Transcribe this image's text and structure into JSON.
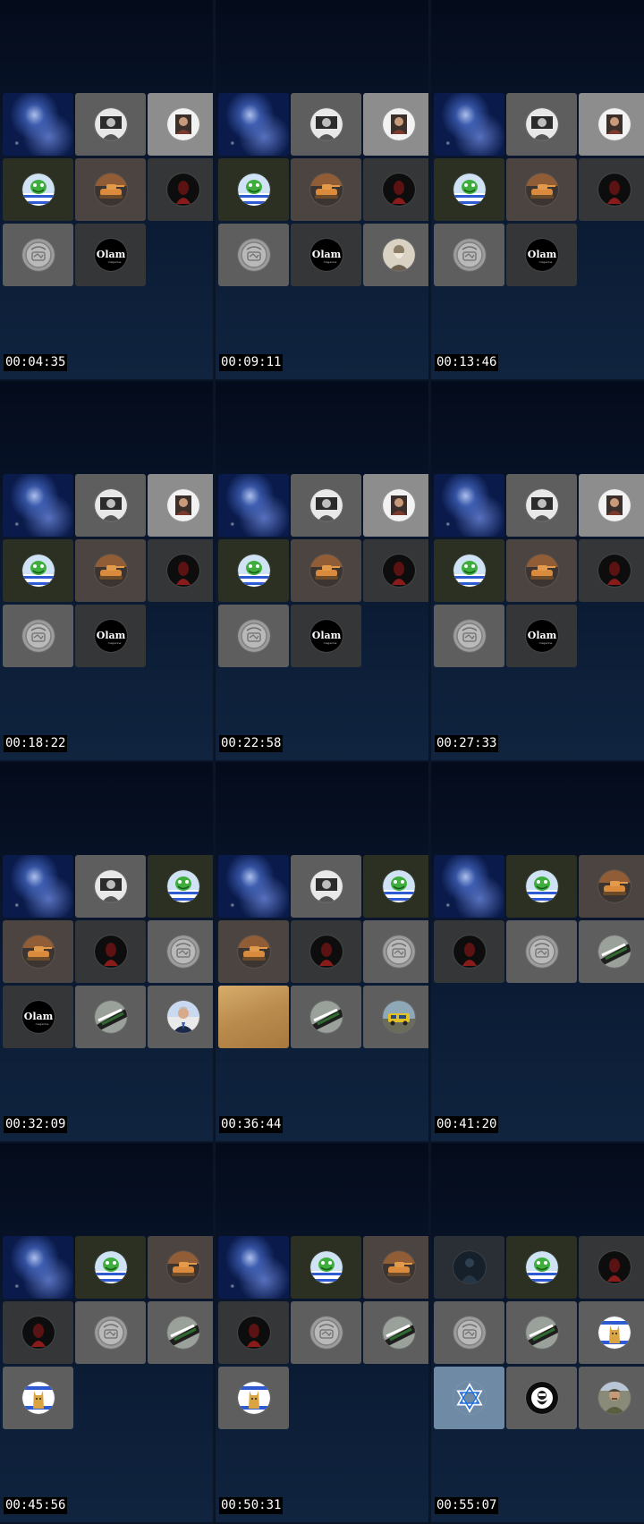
{
  "frames": [
    {
      "timestamp": "00:04:35",
      "tiles": [
        {
          "bg": "nebula"
        },
        {
          "bg": "gray",
          "icon": "portrait-bw-icon"
        },
        {
          "bg": "light",
          "icon": "portrait-photo-icon"
        },
        {
          "bg": "olive",
          "icon": "green-character-flag-icon"
        },
        {
          "bg": "brown",
          "icon": "tank-icon"
        },
        {
          "bg": "dark",
          "icon": "red-figure-icon"
        },
        {
          "bg": "gray",
          "icon": "coin-emblem-icon"
        },
        {
          "bg": "dark",
          "icon": "olam-logo-icon"
        }
      ]
    },
    {
      "timestamp": "00:09:11",
      "tiles": [
        {
          "bg": "nebula"
        },
        {
          "bg": "gray",
          "icon": "portrait-bw-icon"
        },
        {
          "bg": "light",
          "icon": "portrait-photo-icon"
        },
        {
          "bg": "olive",
          "icon": "green-character-flag-icon"
        },
        {
          "bg": "brown",
          "icon": "tank-icon"
        },
        {
          "bg": "dark",
          "icon": "red-figure-icon"
        },
        {
          "bg": "gray",
          "icon": "coin-emblem-icon"
        },
        {
          "bg": "dark",
          "icon": "olam-logo-icon"
        },
        {
          "bg": "gray",
          "icon": "old-man-portrait-icon"
        }
      ]
    },
    {
      "timestamp": "00:13:46",
      "tiles": [
        {
          "bg": "nebula"
        },
        {
          "bg": "gray",
          "icon": "portrait-bw-icon"
        },
        {
          "bg": "light",
          "icon": "portrait-photo-icon"
        },
        {
          "bg": "olive",
          "icon": "green-character-flag-icon"
        },
        {
          "bg": "brown",
          "icon": "tank-icon"
        },
        {
          "bg": "dark",
          "icon": "red-figure-icon"
        },
        {
          "bg": "gray",
          "icon": "coin-emblem-icon"
        },
        {
          "bg": "dark",
          "icon": "olam-logo-icon"
        }
      ]
    },
    {
      "timestamp": "00:18:22",
      "tiles": [
        {
          "bg": "nebula"
        },
        {
          "bg": "gray",
          "icon": "portrait-bw-icon"
        },
        {
          "bg": "light",
          "icon": "portrait-photo-icon"
        },
        {
          "bg": "olive",
          "icon": "green-character-flag-icon"
        },
        {
          "bg": "brown",
          "icon": "tank-icon"
        },
        {
          "bg": "dark",
          "icon": "red-figure-icon"
        },
        {
          "bg": "gray",
          "icon": "coin-emblem-icon"
        },
        {
          "bg": "dark",
          "icon": "olam-logo-icon"
        }
      ]
    },
    {
      "timestamp": "00:22:58",
      "tiles": [
        {
          "bg": "nebula"
        },
        {
          "bg": "gray",
          "icon": "portrait-bw-icon"
        },
        {
          "bg": "light",
          "icon": "portrait-photo-icon"
        },
        {
          "bg": "olive",
          "icon": "green-character-flag-icon"
        },
        {
          "bg": "brown",
          "icon": "tank-icon"
        },
        {
          "bg": "dark",
          "icon": "red-figure-icon"
        },
        {
          "bg": "gray",
          "icon": "coin-emblem-icon"
        },
        {
          "bg": "dark",
          "icon": "olam-logo-icon"
        }
      ]
    },
    {
      "timestamp": "00:27:33",
      "tiles": [
        {
          "bg": "nebula"
        },
        {
          "bg": "gray",
          "icon": "portrait-bw-icon"
        },
        {
          "bg": "light",
          "icon": "portrait-photo-icon"
        },
        {
          "bg": "olive",
          "icon": "green-character-flag-icon"
        },
        {
          "bg": "brown",
          "icon": "tank-icon"
        },
        {
          "bg": "dark",
          "icon": "red-figure-icon"
        },
        {
          "bg": "gray",
          "icon": "coin-emblem-icon"
        },
        {
          "bg": "dark",
          "icon": "olam-logo-icon"
        }
      ]
    },
    {
      "timestamp": "00:32:09",
      "tiles": [
        {
          "bg": "nebula"
        },
        {
          "bg": "gray",
          "icon": "portrait-bw-icon"
        },
        {
          "bg": "olive",
          "icon": "green-character-flag-icon"
        },
        {
          "bg": "brown",
          "icon": "tank-icon"
        },
        {
          "bg": "dark",
          "icon": "red-figure-icon"
        },
        {
          "bg": "gray",
          "icon": "coin-emblem-icon"
        },
        {
          "bg": "dark",
          "icon": "olam-logo-icon"
        },
        {
          "bg": "gray",
          "icon": "soldier-flag-icon"
        },
        {
          "bg": "gray",
          "icon": "politician-portrait-icon"
        }
      ]
    },
    {
      "timestamp": "00:36:44",
      "tiles": [
        {
          "bg": "nebula"
        },
        {
          "bg": "gray",
          "icon": "portrait-bw-icon"
        },
        {
          "bg": "olive",
          "icon": "green-character-flag-icon"
        },
        {
          "bg": "brown",
          "icon": "tank-icon"
        },
        {
          "bg": "dark",
          "icon": "red-figure-icon"
        },
        {
          "bg": "gray",
          "icon": "coin-emblem-icon"
        },
        {
          "bg": "sand"
        },
        {
          "bg": "gray",
          "icon": "soldier-flag-icon"
        },
        {
          "bg": "gray",
          "icon": "vehicle-photo-icon"
        }
      ]
    },
    {
      "timestamp": "00:41:20",
      "tiles": [
        {
          "bg": "nebula"
        },
        {
          "bg": "olive",
          "icon": "green-character-flag-icon"
        },
        {
          "bg": "brown",
          "icon": "tank-icon"
        },
        {
          "bg": "dark",
          "icon": "red-figure-icon"
        },
        {
          "bg": "gray",
          "icon": "coin-emblem-icon"
        },
        {
          "bg": "gray",
          "icon": "soldier-flag-icon"
        }
      ]
    },
    {
      "timestamp": "00:45:56",
      "tiles": [
        {
          "bg": "nebula"
        },
        {
          "bg": "olive",
          "icon": "green-character-flag-icon"
        },
        {
          "bg": "brown",
          "icon": "tank-icon"
        },
        {
          "bg": "dark",
          "icon": "red-figure-icon"
        },
        {
          "bg": "gray",
          "icon": "coin-emblem-icon"
        },
        {
          "bg": "gray",
          "icon": "soldier-flag-icon"
        },
        {
          "bg": "gray",
          "icon": "cat-flag-icon"
        }
      ]
    },
    {
      "timestamp": "00:50:31",
      "tiles": [
        {
          "bg": "nebula"
        },
        {
          "bg": "olive",
          "icon": "green-character-flag-icon"
        },
        {
          "bg": "brown",
          "icon": "tank-icon"
        },
        {
          "bg": "dark",
          "icon": "red-figure-icon"
        },
        {
          "bg": "gray",
          "icon": "coin-emblem-icon"
        },
        {
          "bg": "gray",
          "icon": "soldier-flag-icon"
        },
        {
          "bg": "gray",
          "icon": "cat-flag-icon"
        }
      ]
    },
    {
      "timestamp": "00:55:07",
      "tiles": [
        {
          "bg": "shadow",
          "icon": "dark-figure-icon"
        },
        {
          "bg": "olive",
          "icon": "green-character-flag-icon"
        },
        {
          "bg": "dark",
          "icon": "red-figure-icon"
        },
        {
          "bg": "gray",
          "icon": "coin-emblem-icon"
        },
        {
          "bg": "gray",
          "icon": "soldier-flag-icon"
        },
        {
          "bg": "gray",
          "icon": "cat-flag-icon"
        },
        {
          "bg": "blue",
          "icon": "star-of-david-icon"
        },
        {
          "bg": "gray",
          "icon": "bearded-face-icon"
        },
        {
          "bg": "gray",
          "icon": "soldier-photo-icon"
        }
      ]
    }
  ],
  "avatar_logo_text": "Olam"
}
